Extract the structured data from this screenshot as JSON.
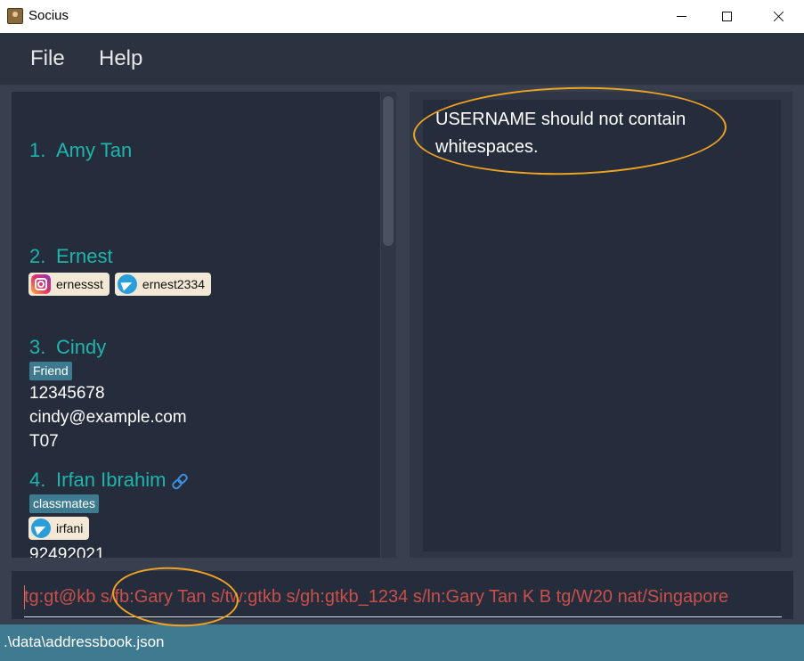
{
  "window": {
    "title": "Socius"
  },
  "menu": {
    "items": [
      "File",
      "Help"
    ]
  },
  "persons": [
    {
      "index": "1.",
      "name": "Amy Tan"
    },
    {
      "index": "2.",
      "name": "Ernest",
      "socials": [
        {
          "platform": "instagram",
          "handle": "ernessst"
        },
        {
          "platform": "telegram",
          "handle": "ernest2334"
        }
      ]
    },
    {
      "index": "3.",
      "name": "Cindy",
      "tag": "Friend",
      "phone": "12345678",
      "email": "cindy@example.com",
      "group": "T07"
    },
    {
      "index": "4.",
      "name": "Irfan Ibrahim",
      "tag": "classmates",
      "socials": [
        {
          "platform": "telegram",
          "handle": "irfani"
        }
      ],
      "phone": "92492021"
    }
  ],
  "result": {
    "message": "USERNAME should not contain whitespaces."
  },
  "command": {
    "value": "tg:gt@kb s/fb:Gary Tan s/tw:gtkb s/gh:gtkb_1234 s/ln:Gary Tan K B tg/W20 nat/Singapore"
  },
  "status": {
    "path": ".\\data\\addressbook.json"
  },
  "colors": {
    "accent": "#1fb5ad",
    "error": "#c9504a",
    "status_bar": "#3e7b91",
    "annotation": "#f0a323"
  }
}
